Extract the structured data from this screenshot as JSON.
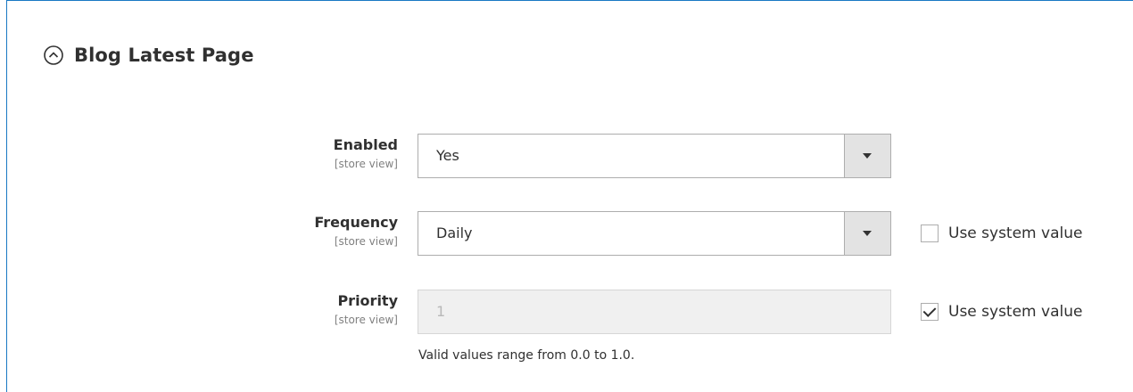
{
  "section": {
    "title": "Blog Latest Page",
    "icon": "collapse-circle-icon"
  },
  "fields": {
    "enabled": {
      "label": "Enabled",
      "scope": "[store view]",
      "value": "Yes"
    },
    "frequency": {
      "label": "Frequency",
      "scope": "[store view]",
      "value": "Daily",
      "use_system_label": "Use system value",
      "use_system_checked": false
    },
    "priority": {
      "label": "Priority",
      "scope": "[store view]",
      "value": "1",
      "note": "Valid values range from 0.0 to 1.0.",
      "use_system_label": "Use system value",
      "use_system_checked": true
    }
  },
  "colors": {
    "panel_border": "#1979c3",
    "select_arrow_bg": "#e3e3e3",
    "disabled_bg": "#f0f0f0"
  }
}
